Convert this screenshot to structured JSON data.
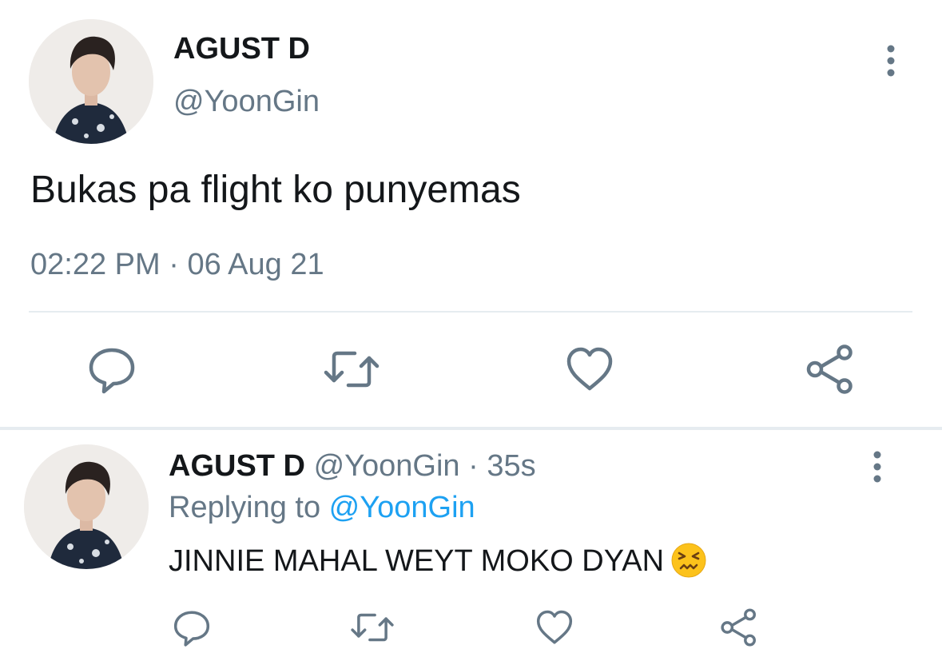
{
  "main_tweet": {
    "display_name": "AGUST D",
    "handle": "@YoonGin",
    "text": "Bukas pa flight ko punyemas",
    "time": "02:22 PM",
    "date_separator": " · ",
    "date": "06 Aug 21",
    "avatar_icon": "profile-photo",
    "more_icon": "vertical-ellipsis-icon",
    "actions": {
      "reply_icon": "comment-icon",
      "retweet_icon": "retweet-icon",
      "like_icon": "heart-icon",
      "share_icon": "share-icon"
    }
  },
  "reply_tweet": {
    "display_name": "AGUST D",
    "handle": "@YoonGin",
    "time_separator": " · ",
    "time_ago": "35s",
    "replying_prefix": "Replying to ",
    "replying_to": "@YoonGin",
    "text": "JINNIE MAHAL WEYT MOKO DYAN",
    "emoji": "confounded-face-emoji",
    "more_icon": "vertical-ellipsis-icon"
  },
  "colors": {
    "text_primary": "#14171a",
    "text_secondary": "#657786",
    "link": "#1da1f2",
    "divider": "#e6ecf0",
    "icon": "#657786"
  }
}
